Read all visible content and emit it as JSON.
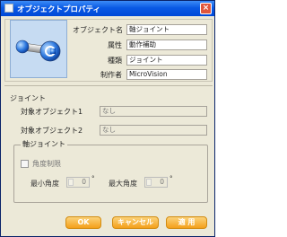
{
  "window": {
    "title": "オブジェクトプロパティ"
  },
  "object": {
    "name_label": "オブジェクト名",
    "name_value": "軸ジョイント",
    "attr_label": "属性",
    "attr_value": "動作補助",
    "type_label": "種類",
    "type_value": "ジョイント",
    "author_label": "制作者",
    "author_value": "MicroVision"
  },
  "joint": {
    "section_label": "ジョイント",
    "target1_label": "対象オブジェクト1",
    "target1_value": "なし",
    "target2_label": "対象オブジェクト2",
    "target2_value": "なし"
  },
  "axis": {
    "group_label": "軸ジョイント",
    "limit_label": "角度制限",
    "limit_checked": false,
    "min_label": "最小角度",
    "min_value": "0",
    "max_label": "最大角度",
    "max_value": "0",
    "degree_symbol": "°"
  },
  "buttons": {
    "ok": "OK",
    "cancel": "キャンセル",
    "apply": "適 用"
  },
  "icons": {
    "object_preview": "joint-axis-icon",
    "window_icon": "window-app-icon"
  },
  "colors": {
    "titlebar": "#0a5ae4",
    "button": "#f4a01a",
    "icon_bg": "#c6dbf2"
  }
}
